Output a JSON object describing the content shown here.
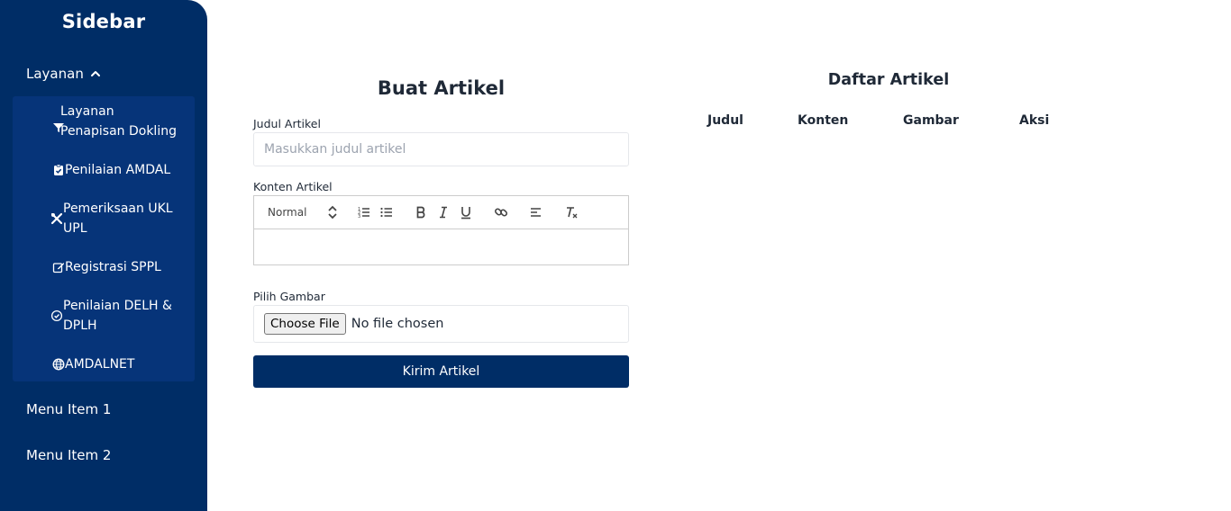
{
  "sidebar": {
    "title": "Sidebar",
    "section": {
      "label": "Layanan",
      "icon": "chevron-up-icon"
    },
    "subitems": [
      {
        "label": "Layanan Penapisan Dokling",
        "line1": "Layanan",
        "line2": "Penapisan Dokling",
        "icon": "filter-icon"
      },
      {
        "label": "Penilaian AMDAL",
        "icon": "clipboard-check-icon"
      },
      {
        "label": "Pemeriksaan UKL UPL",
        "line1": "Pemeriksaan UKL",
        "line2": "UPL",
        "icon": "tools-icon"
      },
      {
        "label": "Registrasi SPPL",
        "icon": "edit-icon"
      },
      {
        "label": "Penilaian DELH & DPLH",
        "line1": "Penilaian DELH &",
        "line2": "DPLH",
        "icon": "check-circle-icon"
      },
      {
        "label": "AMDALNET",
        "icon": "globe-icon"
      }
    ],
    "menu_items": [
      "Menu Item 1",
      "Menu Item 2"
    ],
    "bg_color": "#002d66",
    "submenu_color": "#063479"
  },
  "form": {
    "title": "Buat Artikel",
    "judul_label": "Judul Artikel",
    "judul_placeholder": "Masukkan judul artikel",
    "judul_value": "",
    "konten_label": "Konten Artikel",
    "editor": {
      "format_value": "Normal",
      "tools": [
        "ordered-list-icon",
        "bullet-list-icon",
        "bold-icon",
        "italic-icon",
        "underline-icon",
        "link-icon",
        "align-icon",
        "clear-format-icon"
      ]
    },
    "gambar_label": "Pilih Gambar",
    "choose_file_label": "Choose File",
    "file_status": "No file chosen",
    "submit_label": "Kirim Artikel",
    "accent_color": "#002d66"
  },
  "list": {
    "title": "Daftar Artikel",
    "columns": [
      "Judul",
      "Konten",
      "Gambar",
      "Aksi"
    ],
    "rows": []
  }
}
